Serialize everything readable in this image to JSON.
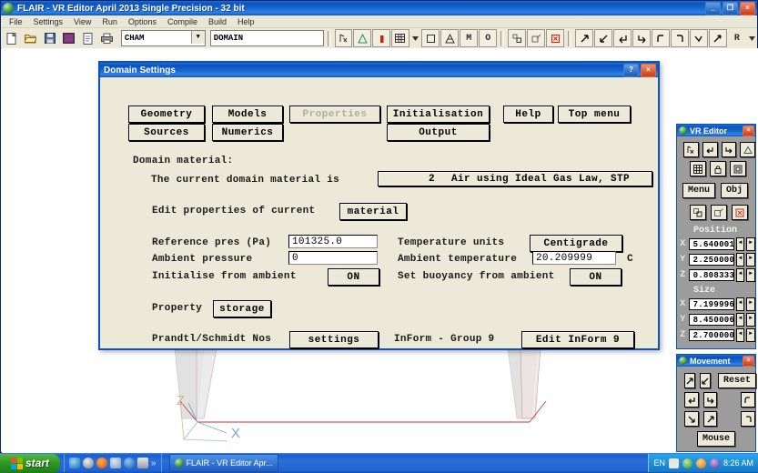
{
  "app": {
    "title": "FLAIR - VR Editor April 2013 Single Precision - 32 bit",
    "minimize": "_",
    "restore": "❐",
    "close": "×",
    "menu": [
      "File",
      "Settings",
      "View",
      "Run",
      "Options",
      "Compile",
      "Build",
      "Help"
    ],
    "toolbar": {
      "case_combo_value": "CHAM",
      "case_combo_arrow": "▼",
      "title_field_value": "DOMAIN",
      "icons": [
        "new-file-icon",
        "open-folder-icon",
        "save-disk-icon",
        "palette-icon",
        "document-icon",
        "print-icon"
      ],
      "tool_icons": [
        "cursor-probe-icon",
        "triangle-icon",
        "red-block-icon",
        "grid-icon",
        "dropdown-arrow-icon",
        "square-icon",
        "cone-icon",
        "letter-m-icon",
        "letter-o-icon",
        "small-object-icon",
        "edit-object-icon",
        "delete-object-icon",
        "arrow-up-right-icon",
        "arrow-down-left-icon",
        "arrow-return-icon",
        "arrow-hook-icon",
        "rotate-left-icon",
        "rotate-right-icon",
        "arrow-down-icon",
        "arrow-up-icon"
      ],
      "r_label": "R",
      "r_arrow": "▼"
    }
  },
  "viewport": {
    "axis_z": "Z",
    "axis_x": "X"
  },
  "dialog": {
    "title": "Domain Settings",
    "help_btn": "?",
    "close_btn": "×",
    "top_buttons_row1": [
      {
        "label": "Geometry",
        "name": "geometry-button",
        "disabled": false
      },
      {
        "label": "Models",
        "name": "models-button",
        "disabled": false
      },
      {
        "label": "Properties",
        "name": "properties-button",
        "disabled": true
      },
      {
        "label": "Initialisation",
        "name": "initialisation-button",
        "disabled": false
      },
      {
        "label": "Help",
        "name": "help-button",
        "disabled": false
      },
      {
        "label": "Top menu",
        "name": "top-menu-button",
        "disabled": false
      }
    ],
    "top_buttons_row2": [
      {
        "label": "Sources",
        "name": "sources-button",
        "disabled": false
      },
      {
        "label": "Numerics",
        "name": "numerics-button",
        "disabled": false
      },
      {
        "label": "Output",
        "name": "output-button",
        "disabled": false
      }
    ],
    "section_material_heading": "Domain material:",
    "current_material_label": "The current domain material is",
    "current_material_index": "2",
    "current_material_name": "Air using Ideal Gas Law, STP",
    "edit_properties_label": "Edit properties of current",
    "edit_properties_button": "material",
    "reference_pressure_label": "Reference pres (Pa)",
    "reference_pressure_value": "101325.0",
    "ambient_pressure_label": "Ambient pressure",
    "ambient_pressure_value": "0",
    "initialise_from_ambient_label": "Initialise from ambient",
    "initialise_from_ambient_value": "ON",
    "temperature_units_label": "Temperature units",
    "temperature_units_value": "Centigrade",
    "ambient_temperature_label": "Ambient temperature",
    "ambient_temperature_value": "20.209999",
    "ambient_temperature_unit": "C",
    "set_buoyancy_label": "Set buoyancy from ambient",
    "set_buoyancy_value": "ON",
    "property_label": "Property",
    "property_button": "storage",
    "prandtl_label": "Prandtl/Schmidt Nos",
    "prandtl_button": "settings",
    "inform_label": "InForm - Group 9",
    "inform_button": "Edit InForm 9"
  },
  "vr_editor": {
    "title": "VR Editor",
    "close": "×",
    "row1_icons": [
      "probe-tool-icon",
      "import-arrow-icon",
      "export-arrow-icon",
      "shape-icon"
    ],
    "row2_icons": [
      "grid-view-icon",
      "lock-icon",
      "object-box-icon"
    ],
    "menu_button": "Menu",
    "obj_button": "Obj",
    "row3_icons": [
      "duplicate-object-icon",
      "edit-geometry-icon",
      "delete-icon"
    ],
    "position_heading": "Position",
    "size_heading": "Size",
    "position": [
      {
        "axis": "X",
        "value": "5.640001"
      },
      {
        "axis": "Y",
        "value": "2.250000"
      },
      {
        "axis": "Z",
        "value": "0.808333"
      }
    ],
    "size": [
      {
        "axis": "X",
        "value": "7.199996"
      },
      {
        "axis": "Y",
        "value": "8.450006"
      },
      {
        "axis": "Z",
        "value": "2.700000"
      }
    ],
    "spin_left": "◄",
    "spin_right": "►"
  },
  "movement": {
    "title": "Movement",
    "close": "×",
    "icons": [
      "move-up-right-icon",
      "move-down-left-icon",
      "move-return-left-icon",
      "move-return-right-icon",
      "move-down-icon",
      "move-up-icon"
    ],
    "reset_button": "Reset",
    "rotate_left_icon": "rotate-ccw-icon",
    "rotate_right_icon": "rotate-cw-icon",
    "mouse_button": "Mouse"
  },
  "taskbar": {
    "start_label": "start",
    "quick_icons": [
      "ie-browser-icon",
      "media-player-icon",
      "firefox-icon",
      "msn-icon",
      "outlook-icon",
      "notepad-icon"
    ],
    "quick_overflow": "»",
    "task_label": "FLAIR - VR Editor Apr...",
    "tray_lang": "EN",
    "tray_icons": [
      "network-icon",
      "volume-icon",
      "shield-icon",
      "usb-icon"
    ],
    "clock": "8:26 AM"
  },
  "colors": {
    "title_blue": "#0a52bd",
    "dialog_face": "#ece9d8",
    "panel_gray": "#9c9c9c",
    "accent_red": "#cc2200"
  }
}
